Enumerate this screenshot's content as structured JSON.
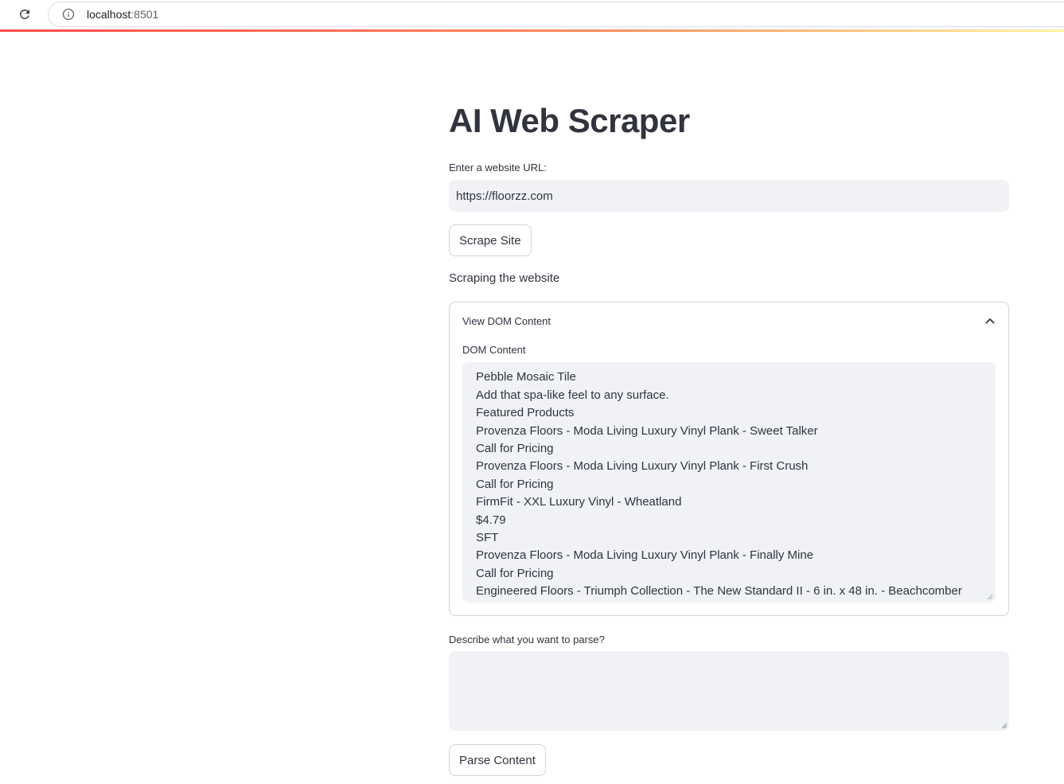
{
  "browser": {
    "address_host": "localhost",
    "address_port": ":8501"
  },
  "page": {
    "title": "AI Web Scraper"
  },
  "url_field": {
    "label": "Enter a website URL:",
    "value": "https://floorzz.com"
  },
  "scrape_button": {
    "label": "Scrape Site"
  },
  "status": {
    "text": "Scraping the website"
  },
  "expander": {
    "title": "View DOM Content",
    "dom_label": "DOM Content",
    "lines": [
      "Pebble Mosaic Tile",
      "Add that spa-like feel to any surface.",
      "Featured Products",
      "Provenza Floors - Moda Living Luxury Vinyl Plank - Sweet Talker",
      "Call for Pricing",
      "Provenza Floors - Moda Living Luxury Vinyl Plank - First Crush",
      "Call for Pricing",
      "FirmFit - XXL Luxury Vinyl - Wheatland",
      "$4.79",
      "SFT",
      "Provenza Floors - Moda Living Luxury Vinyl Plank - Finally Mine",
      "Call for Pricing",
      "Engineered Floors - Triumph Collection - The New Standard II - 6 in. x 48 in. - Beachcomber"
    ]
  },
  "parse_field": {
    "label": "Describe what you want to parse?",
    "value": ""
  },
  "parse_button": {
    "label": "Parse Content"
  },
  "colors": {
    "accent_red": "#ff4b4b",
    "input_bg": "#f0f2f6",
    "text": "#31333f"
  }
}
